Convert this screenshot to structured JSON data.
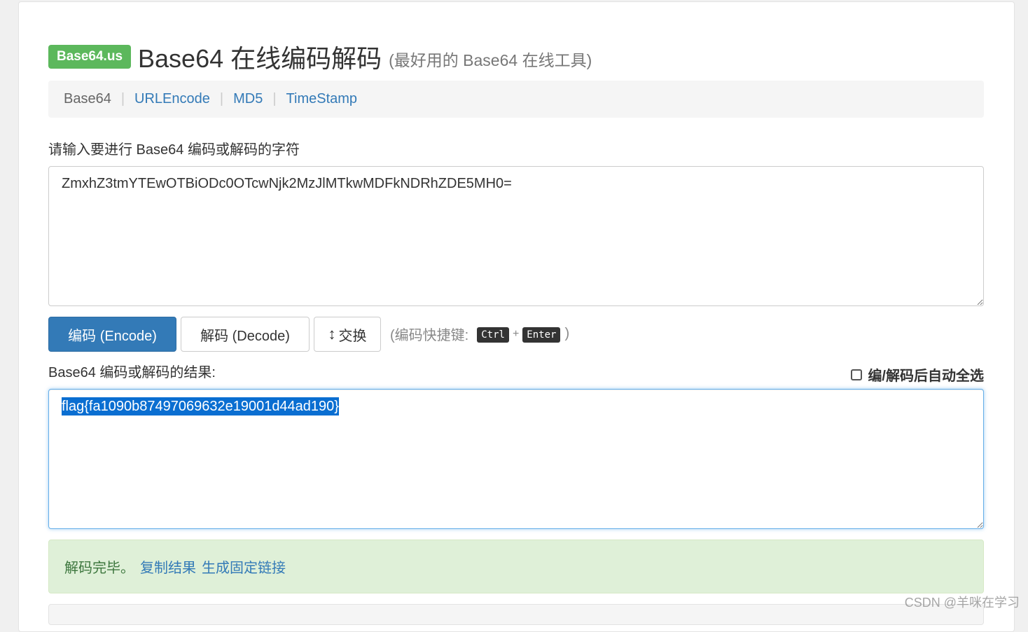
{
  "header": {
    "brand": "Base64.us",
    "title": "Base64 在线编码解码",
    "subtitle": "(最好用的 Base64 在线工具)"
  },
  "nav": {
    "items": [
      {
        "label": "Base64",
        "active": true
      },
      {
        "label": "URLEncode",
        "active": false
      },
      {
        "label": "MD5",
        "active": false
      },
      {
        "label": "TimeStamp",
        "active": false
      }
    ],
    "separator": "|"
  },
  "input": {
    "label": "请输入要进行 Base64 编码或解码的字符",
    "value": "ZmxhZ3tmYTEwOTBiODc0OTcwNjk2MzJlMTkwMDFkNDRhZDE5MH0="
  },
  "actions": {
    "encode_label": "编码 (Encode)",
    "decode_label": "解码 (Decode)",
    "swap_icon": "up-down-arrow-icon",
    "swap_label": "交换",
    "shortcut_prefix": "(编码快捷键:",
    "shortcut_key1": "Ctrl",
    "shortcut_plus": "+",
    "shortcut_key2": "Enter",
    "shortcut_suffix": ")"
  },
  "result": {
    "label": "Base64 编码或解码的结果:",
    "autoselect_label": "编/解码后自动全选",
    "autoselect_checked": false,
    "value": "flag{fa1090b87497069632e19001d44ad190}",
    "selected": true
  },
  "alert": {
    "status": "解码完毕。",
    "copy_link": "复制结果",
    "permalink_link": "生成固定链接"
  },
  "watermark": "CSDN @羊咪在学习",
  "colors": {
    "brand_green": "#5cb85c",
    "primary_blue": "#337ab7",
    "success_bg": "#dff0d8",
    "selection_blue": "#0a6ed1"
  }
}
